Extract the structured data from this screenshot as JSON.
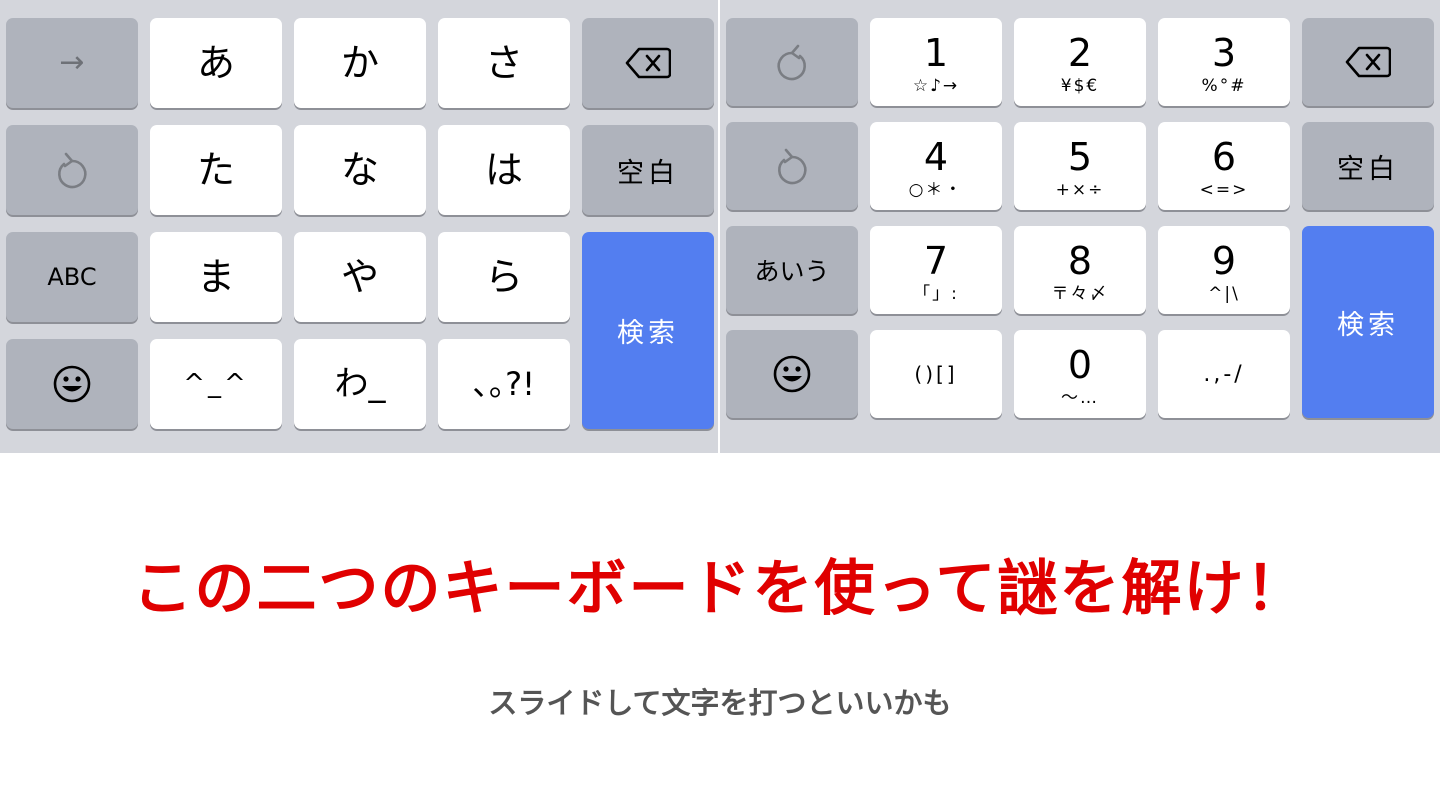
{
  "left_keyboard": {
    "row1": {
      "arrow_glyph": "→",
      "a": "あ",
      "ka": "か",
      "sa": "さ"
    },
    "row2": {
      "ta": "た",
      "na": "な",
      "ha": "は",
      "space": "空白"
    },
    "row3": {
      "abc": "ABC",
      "ma": "ま",
      "ya": "や",
      "ra": "ら",
      "search": "検索"
    },
    "row4": {
      "kaomoji": "^_^",
      "wa": "わ_",
      "punct": "､｡?!"
    }
  },
  "right_keyboard": {
    "row1": {
      "k1": {
        "main": "1",
        "sub": "☆♪→"
      },
      "k2": {
        "main": "2",
        "sub": "¥$€"
      },
      "k3": {
        "main": "3",
        "sub": "%°#"
      }
    },
    "row2": {
      "k4": {
        "main": "4",
        "sub": "○＊・"
      },
      "k5": {
        "main": "5",
        "sub": "+×÷"
      },
      "k6": {
        "main": "6",
        "sub": "<=>"
      },
      "space": "空白"
    },
    "row3": {
      "kana": "あいう",
      "k7": {
        "main": "7",
        "sub": "「」:"
      },
      "k8": {
        "main": "8",
        "sub": "〒々〆"
      },
      "k9": {
        "main": "9",
        "sub": "^|\\"
      },
      "search": "検索"
    },
    "row4": {
      "brackets": "()[]",
      "k0": {
        "main": "0",
        "sub": "〜…"
      },
      "punct": ".,-/"
    }
  },
  "headline": "この二つのキーボードを使って謎を解け！",
  "hint": "スライドして文字を打つといいかも",
  "colors": {
    "accent_blue": "#537ef0",
    "headline_red": "#e00000",
    "keyboard_bg": "#d4d6dc"
  }
}
